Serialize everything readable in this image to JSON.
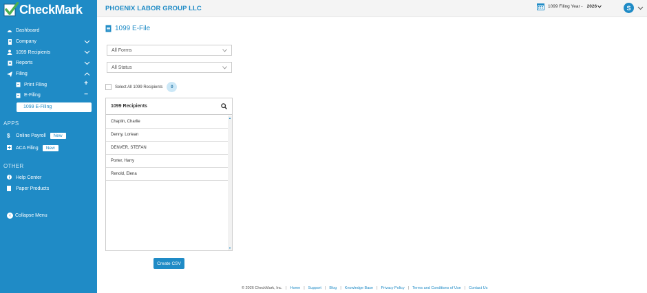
{
  "brand": {
    "name": "CheckMark"
  },
  "sidebar": {
    "items": [
      {
        "label": "Dashboard",
        "icon": "dashboard-icon"
      },
      {
        "label": "Company",
        "icon": "building-icon"
      },
      {
        "label": "1099 Recipients",
        "icon": "person-icon"
      },
      {
        "label": "Reports",
        "icon": "report-icon"
      },
      {
        "label": "Filing",
        "icon": "send-icon"
      }
    ],
    "sub_items": [
      {
        "label": "Print Filing",
        "toggle": "+"
      },
      {
        "label": "E-Filing",
        "toggle": "−"
      }
    ],
    "active_item": "1099 E-Filing",
    "apps_title": "APPS",
    "apps": [
      {
        "label": "Online Payroll",
        "badge": "New"
      },
      {
        "label": "ACA Filing",
        "badge": "New"
      }
    ],
    "other_title": "OTHER",
    "other": [
      {
        "label": "Help Center"
      },
      {
        "label": "Paper Products"
      }
    ],
    "collapse_label": "Collapse Menu"
  },
  "header": {
    "company": "PHOENIX LABOR GROUP LLC",
    "year_label": "1099 Filing Year -",
    "year_value": "2026",
    "avatar": "S"
  },
  "main": {
    "title": "1099 E-File",
    "forms_select": "All Forms",
    "status_select": "All Status",
    "select_all_label": "Select All 1099 Recipients",
    "selected_count": "0",
    "recipients_title": "1099 Recipients",
    "recipients": [
      "Chaplin, Charlie",
      "Denny, Loriean",
      "DENVER, STEFAN",
      "Porter, Harry",
      "Renold, Elena"
    ],
    "create_csv": "Create CSV"
  },
  "footer": {
    "copyright": "© 2026 CheckMark, Inc.",
    "links": [
      "Home",
      "Support",
      "Blog",
      "Knowledge Base",
      "Privacy Policy",
      "Terms and Conditions of Use",
      "Contact Us"
    ]
  },
  "colors": {
    "accent": "#1f8bc6",
    "sidebar_bg": "#1f8bc6",
    "header_bg": "#f4f4f4"
  }
}
